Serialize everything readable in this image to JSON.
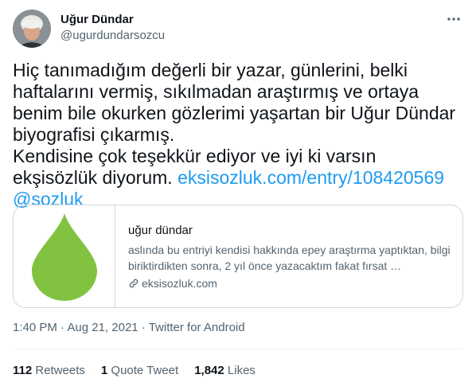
{
  "author": {
    "display_name": "Uğur Dündar",
    "handle": "@ugurdundarsozcu"
  },
  "tweet": {
    "text": "Hiç tanımadığım değerli bir yazar, günlerini, belki haftalarını vermiş, sıkılmadan araştırmış ve ortaya benim bile okurken gözlerimi yaşartan bir Uğur Dündar biyografisi çıkarmış.\nKendisine çok teşekkür ediyor ve iyi ki varsın ekşisözlük diyorum. ",
    "link": "eksisozluk.com/entry/108420569",
    "mention": " @sozluk"
  },
  "card": {
    "title": "uğur dündar",
    "description": "aslında bu entriyi kendisi hakkında epey araştırma yaptıktan, bilgi biriktirdikten sonra, 2 yıl önce yazacaktım fakat fırsat …",
    "domain": "eksisozluk.com",
    "brand_color": "#81c341"
  },
  "meta": {
    "time": "1:40 PM",
    "date": "Aug 21, 2021",
    "source": "Twitter for Android",
    "separator": " · "
  },
  "stats": {
    "retweets_count": "112",
    "retweets_label": " Retweets",
    "quotes_count": "1",
    "quotes_label": " Quote Tweet",
    "likes_count": "1,842",
    "likes_label": " Likes"
  },
  "icons": {
    "more": "more-icon",
    "link": "link-icon"
  }
}
